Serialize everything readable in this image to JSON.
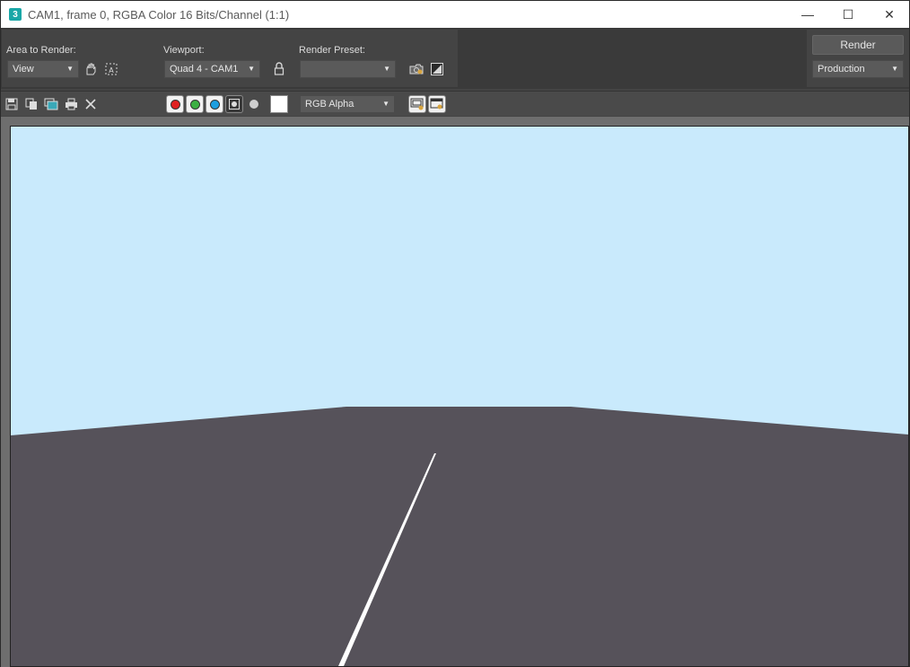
{
  "window": {
    "app_icon_label": "3",
    "title": "CAM1, frame 0, RGBA Color 16 Bits/Channel (1:1)",
    "minimize_glyph": "—",
    "maximize_glyph": "☐",
    "close_glyph": "✕"
  },
  "render_settings": {
    "area_label": "Area to Render:",
    "area_value": "View",
    "viewport_label": "Viewport:",
    "viewport_value": "Quad 4 - CAM1",
    "preset_label": "Render Preset:",
    "preset_value": "",
    "render_button": "Render",
    "mode_value": "Production"
  },
  "toolbar": {
    "display_channel": "RGB Alpha",
    "channels": [
      "red",
      "green",
      "blue",
      "alpha",
      "monochrome"
    ],
    "swatch_color": "#ffffff"
  },
  "scene": {
    "sky_color": "#c9eafc",
    "ground_color": "#56525a",
    "line_color": "#ffffff"
  }
}
